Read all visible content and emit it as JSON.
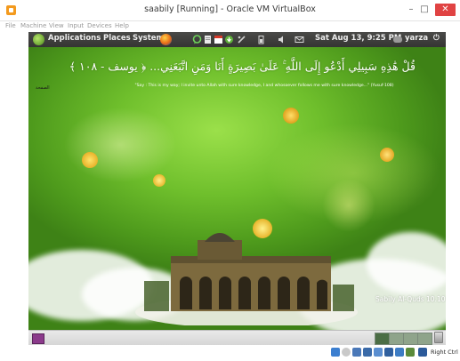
{
  "window": {
    "title": "saabily [Running] - Oracle VM VirtualBox",
    "minimize": "–",
    "maximize": "□",
    "close": "✕"
  },
  "menubar": {
    "items": [
      "File",
      "Machine",
      "View",
      "Input",
      "Devices",
      "Help"
    ]
  },
  "top_panel": {
    "applications": "Applications",
    "places": "Places",
    "system": "System",
    "datetime": "Sat Aug 13,  9:25 PM",
    "user": "yarza",
    "power_glyph": "⏻"
  },
  "desktop": {
    "verse_arabic": "قُلْ هَٰذِهِ سَبِيلِي أَدْعُو إِلَى اللَّهِ ۚ عَلَىٰ بَصِيرَةٍ أَنَا وَمَنِ اتَّبَعَنِي... ﴿ يوسف - ١٠٨ ﴾",
    "verse_english": "\"Say : This is my way; I invite unto Allah with sure knowledge, I and whosoever follows me with sure knowledge...\" (Yusuf-108)",
    "corner_label": "الصفحة",
    "brand": "Sabily Al-Quds 10.10"
  },
  "statusbar": {
    "host_key": "Right Ctrl"
  },
  "colors": {
    "close_button": "#e04343",
    "panel_dark": "#3a3a38",
    "desktop_green": "#6fbf2c"
  }
}
